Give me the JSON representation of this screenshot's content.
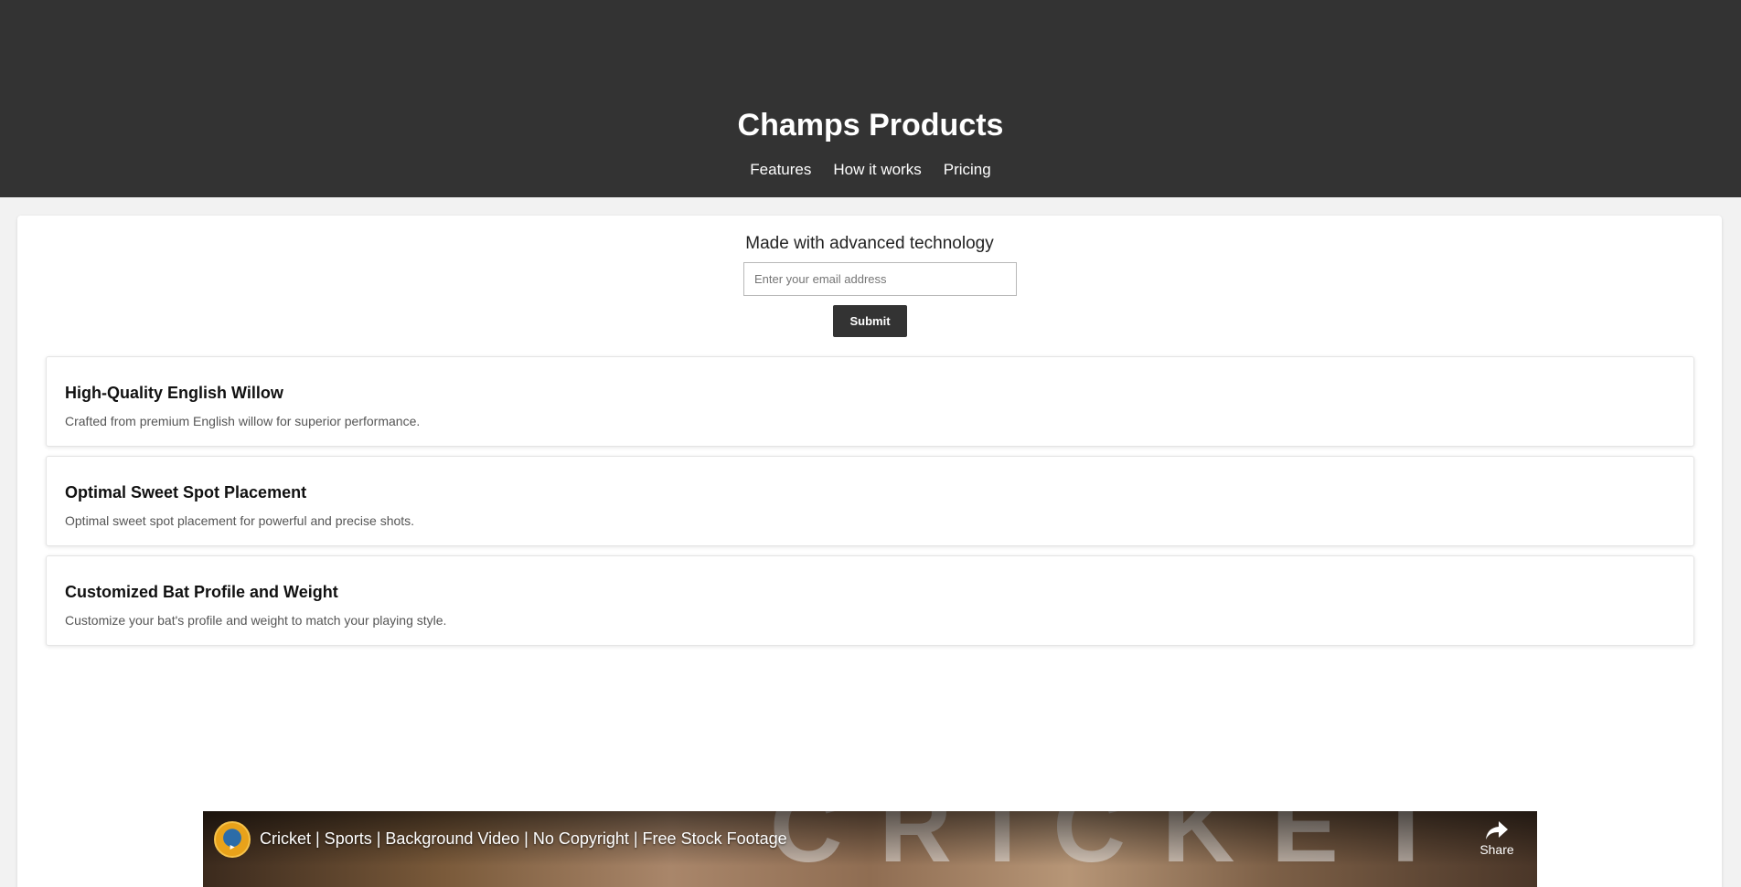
{
  "header": {
    "title": "Champs Products",
    "nav": [
      {
        "label": "Features"
      },
      {
        "label": "How it works"
      },
      {
        "label": "Pricing"
      }
    ]
  },
  "hero": {
    "tagline": "Made with advanced technology",
    "email_placeholder": "Enter your email address",
    "submit_label": "Submit"
  },
  "features": [
    {
      "title": "High-Quality English Willow",
      "description": "Crafted from premium English willow for superior performance."
    },
    {
      "title": "Optimal Sweet Spot Placement",
      "description": "Optimal sweet spot placement for powerful and precise shots."
    },
    {
      "title": "Customized Bat Profile and Weight",
      "description": "Customize your bat's profile and weight to match your playing style."
    }
  ],
  "video": {
    "title": "Cricket | Sports | Background Video | No Copyright | Free Stock Footage",
    "share_label": "Share",
    "background_text": "CRICKET",
    "channel_icon": "channel-logo-icon",
    "share_icon": "share-arrow-icon"
  },
  "colors": {
    "header_bg": "#333333",
    "button_bg": "#333333",
    "page_bg": "#f2f2f2"
  }
}
